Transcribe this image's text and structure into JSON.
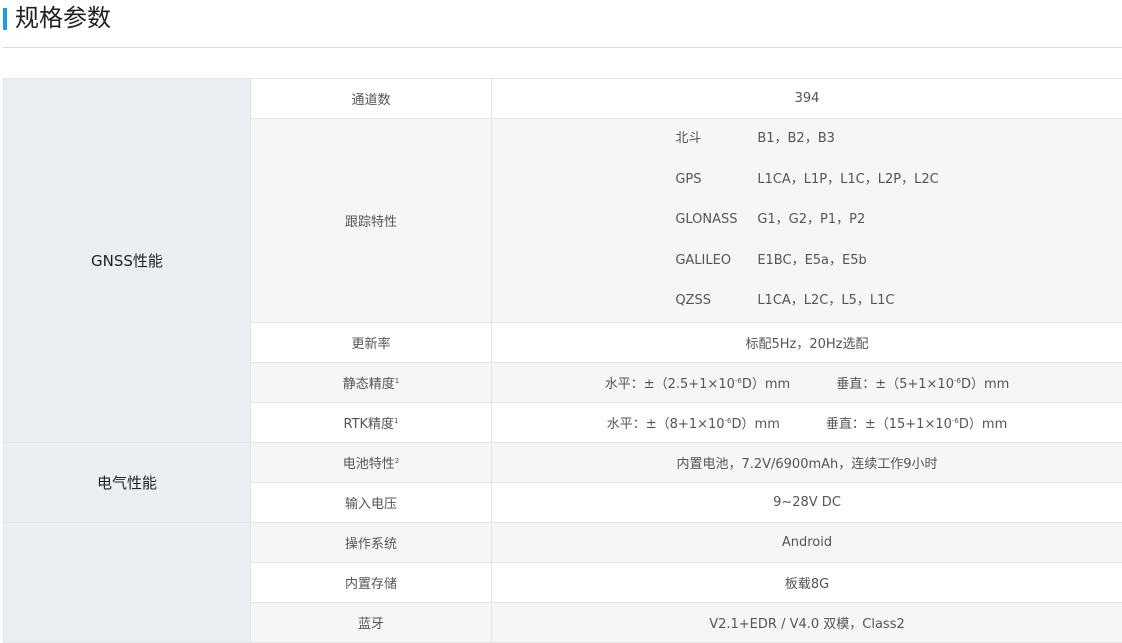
{
  "header": {
    "title": "规格参数"
  },
  "groups": [
    {
      "name": "GNSS性能",
      "rows": [
        {
          "label": "通道数",
          "value": "394"
        },
        {
          "label": "跟踪特性",
          "tracking": [
            {
              "system": "北斗",
              "signals": "B1，B2，B3"
            },
            {
              "system": "GPS",
              "signals": "L1CA，L1P，L1C，L2P，L2C"
            },
            {
              "system": "GLONASS",
              "signals": "G1，G2，P1，P2"
            },
            {
              "system": "GALILEO",
              "signals": "E1BC，E5a，E5b"
            },
            {
              "system": "QZSS",
              "signals": "L1CA，L2C，L5，L1C"
            }
          ]
        },
        {
          "label": "更新率",
          "value": "标配5Hz，20Hz选配"
        },
        {
          "label": "静态精度",
          "note": "1",
          "horizontal": {
            "prefix": "水平：±（2.5+1×10",
            "exp": "-6",
            "suffix": "D）mm"
          },
          "vertical": {
            "prefix": "垂直：±（5+1×10",
            "exp": "-6",
            "suffix": "D）mm"
          }
        },
        {
          "label": "RTK精度",
          "note": "1",
          "horizontal": {
            "prefix": "水平：±（8+1×10",
            "exp": "-6",
            "suffix": "D）mm"
          },
          "vertical": {
            "prefix": "垂直：±（15+1×10",
            "exp": "-6",
            "suffix": "D）mm"
          }
        }
      ]
    },
    {
      "name": "电气性能",
      "rows": [
        {
          "label": "电池特性",
          "note": "2",
          "value": "内置电池，7.2V/6900mAh，连续工作9小时"
        },
        {
          "label": "输入电压",
          "value": "9~28V DC"
        }
      ]
    },
    {
      "name": "",
      "rows": [
        {
          "label": "操作系统",
          "value": "Android"
        },
        {
          "label": "内置存储",
          "value": "板载8G"
        },
        {
          "label": "蓝牙",
          "value": "V2.1+EDR / V4.0 双模，Class2"
        }
      ]
    }
  ]
}
